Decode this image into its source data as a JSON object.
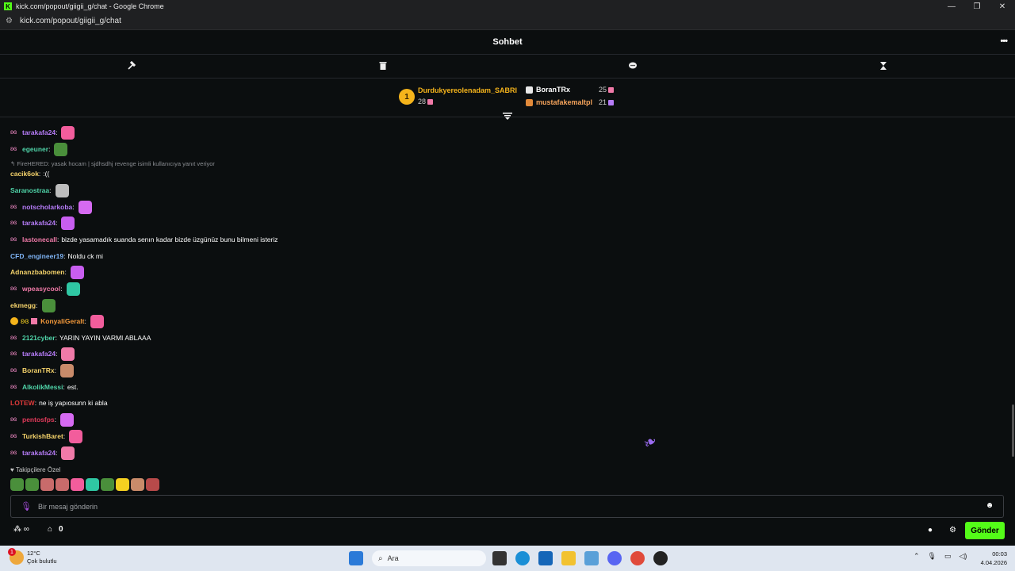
{
  "window": {
    "title": "kick.com/popout/giigii_g/chat - Google Chrome",
    "url": "kick.com/popout/giigii_g/chat",
    "controls": [
      "—",
      "❐",
      "✕"
    ]
  },
  "header": {
    "title": "Sohbet",
    "more": "•••"
  },
  "toolbar": {
    "icons": [
      "hammer-icon",
      "trash-icon",
      "chat-bubble-icon",
      "hourglass-icon"
    ]
  },
  "leaderboard": {
    "first": {
      "rank": "1",
      "name": "Durdukyereolenadam_SABRI",
      "score": "28"
    },
    "second": {
      "name": "BoranTRx",
      "score": "25"
    },
    "third": {
      "name": "mustafakemaltpl",
      "score": "21"
    }
  },
  "messages": [
    {
      "badge": true,
      "user": "tarakafa24",
      "color": "#b67cf8",
      "text": "",
      "emote": "#f25d9c"
    },
    {
      "badge": true,
      "user": "egeuner",
      "color": "#4fd3a8",
      "text": "",
      "emote": "#4a8f3b"
    },
    {
      "badge": false,
      "user": "cacik6ok",
      "color": "#f5d36b",
      "text": ":((",
      "emote": ""
    },
    {
      "badge": false,
      "user": "Saranostraa",
      "color": "#4fd3a8",
      "text": "",
      "emote": "#bdbdbd"
    },
    {
      "badge": true,
      "user": "notscholarkoba",
      "color": "#b67cf8",
      "text": "",
      "emote": "#d66af2"
    },
    {
      "badge": true,
      "user": "tarakafa24",
      "color": "#b67cf8",
      "text": "",
      "emote": "#c85ef0"
    },
    {
      "badge": true,
      "user": "lastonecall",
      "color": "#f07aa8",
      "text": "bizde yasamadık suanda senın kadar bizde üzgünüz bunu bilmeni isteriz",
      "emote": ""
    },
    {
      "badge": false,
      "user": "CFD_engineer19",
      "color": "#7fb4f5",
      "text": "Noldu ck mi",
      "emote": ""
    },
    {
      "badge": false,
      "user": "Adnanzbabomen",
      "color": "#f5d36b",
      "text": "",
      "emote": "#c85ef0"
    },
    {
      "badge": true,
      "user": "wpeasycool",
      "color": "#f07aa8",
      "text": "",
      "emote": "#2fc7a3"
    },
    {
      "badge": false,
      "user": "ekmegg",
      "color": "#f5d36b",
      "text": "",
      "emote": "#4a8f3b"
    },
    {
      "badge": false,
      "user": "KonyaliGeralt",
      "color": "#f59a3b",
      "text": "",
      "emote": "#f25d9c",
      "extra_badges": true
    },
    {
      "badge": true,
      "user": "2121cyber",
      "color": "#4fd3a8",
      "text": "YARIN YAYIN VARMI ABLAAA",
      "emote": ""
    },
    {
      "badge": true,
      "user": "tarakafa24",
      "color": "#b67cf8",
      "text": "",
      "emote": "#f07aa8"
    },
    {
      "badge": true,
      "user": "BoranTRx",
      "color": "#f5d36b",
      "text": "",
      "emote": "#c98b6a"
    },
    {
      "badge": true,
      "user": "AlkolikMessi",
      "color": "#4fd3a8",
      "text": "est.",
      "emote": ""
    },
    {
      "badge": false,
      "user": "LOTEW",
      "color": "#e03a3a",
      "text": "ne iş yapıosunn ki abla",
      "emote": ""
    },
    {
      "badge": true,
      "user": "pentosfps",
      "color": "#e03a5a",
      "text": "",
      "emote": "#d66af2"
    },
    {
      "badge": true,
      "user": "TurkishBaret",
      "color": "#f5d36b",
      "text": "",
      "emote": "#f25d9c"
    },
    {
      "badge": true,
      "user": "tarakafa24",
      "color": "#b67cf8",
      "text": "",
      "emote": "#f07aa8"
    }
  ],
  "reply": {
    "text": "FireHERED: yasak hocam | sjdhsdhj revenge isimli kullanıcıya yanıt veriyor"
  },
  "followers": {
    "label": "Takipçilere Özel",
    "emotes": [
      "#4a8f3b",
      "#4a8f3b",
      "#c86b6b",
      "#c86b6b",
      "#f25d9c",
      "#2fc7a3",
      "#4a8f3b",
      "#f5d020",
      "#c98b6a",
      "#b84a4a"
    ]
  },
  "input": {
    "placeholder": "Bir mesaj gönderin",
    "value": ""
  },
  "bottom": {
    "points": "0",
    "send_label": "Gönder"
  },
  "taskbar": {
    "weather_temp": "12°C",
    "weather_desc": "Çok bulutlu",
    "weather_badge": "1",
    "search_placeholder": "Ara",
    "time": "00:03",
    "date": "4.04.2026"
  },
  "colors": {
    "accent": "#53fc18",
    "background": "#0b0e0f",
    "gold": "#f5b41b"
  }
}
